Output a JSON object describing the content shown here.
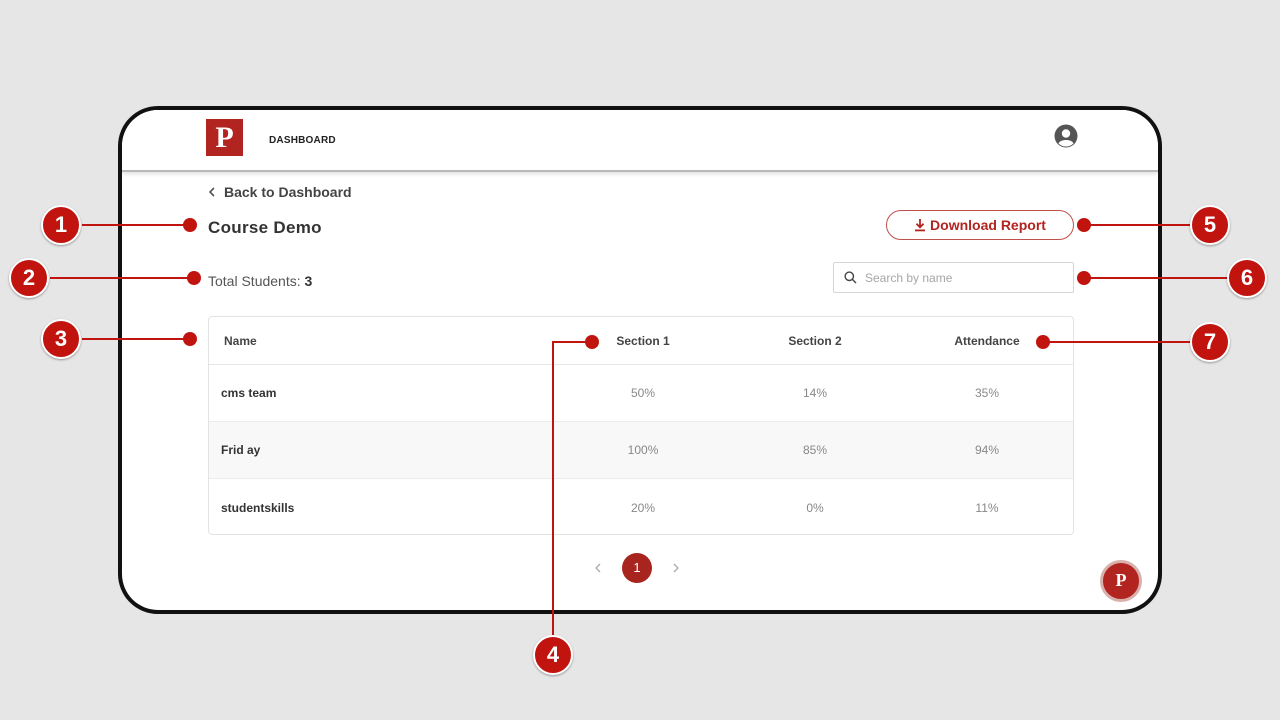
{
  "header": {
    "logo_letter": "P",
    "nav_title": "DASHBOARD"
  },
  "back_link": {
    "label": "Back to Dashboard"
  },
  "course": {
    "title": "Course Demo"
  },
  "download": {
    "label": "Download Report"
  },
  "totals": {
    "label": "Total Students:",
    "count": "3"
  },
  "search": {
    "placeholder": "Search by name"
  },
  "table": {
    "headers": {
      "name": "Name",
      "section1": "Section 1",
      "section2": "Section 2",
      "attendance": "Attendance"
    },
    "rows": [
      {
        "name": "cms team",
        "section1": "50%",
        "section2": "14%",
        "attendance": "35%"
      },
      {
        "name": "Frid ay",
        "section1": "100%",
        "section2": "85%",
        "attendance": "94%"
      },
      {
        "name": "studentskills",
        "section1": "20%",
        "section2": "0%",
        "attendance": "11%"
      }
    ]
  },
  "pagination": {
    "current": "1"
  },
  "help": {
    "letter": "P"
  },
  "callouts": [
    "1",
    "2",
    "3",
    "4",
    "5",
    "6",
    "7"
  ],
  "colors": {
    "brand": "#b2241f",
    "callout": "#c1140f"
  },
  "icons": [
    "user-avatar-icon",
    "chevron-left-icon",
    "download-icon",
    "search-icon",
    "chevron-right-icon"
  ]
}
